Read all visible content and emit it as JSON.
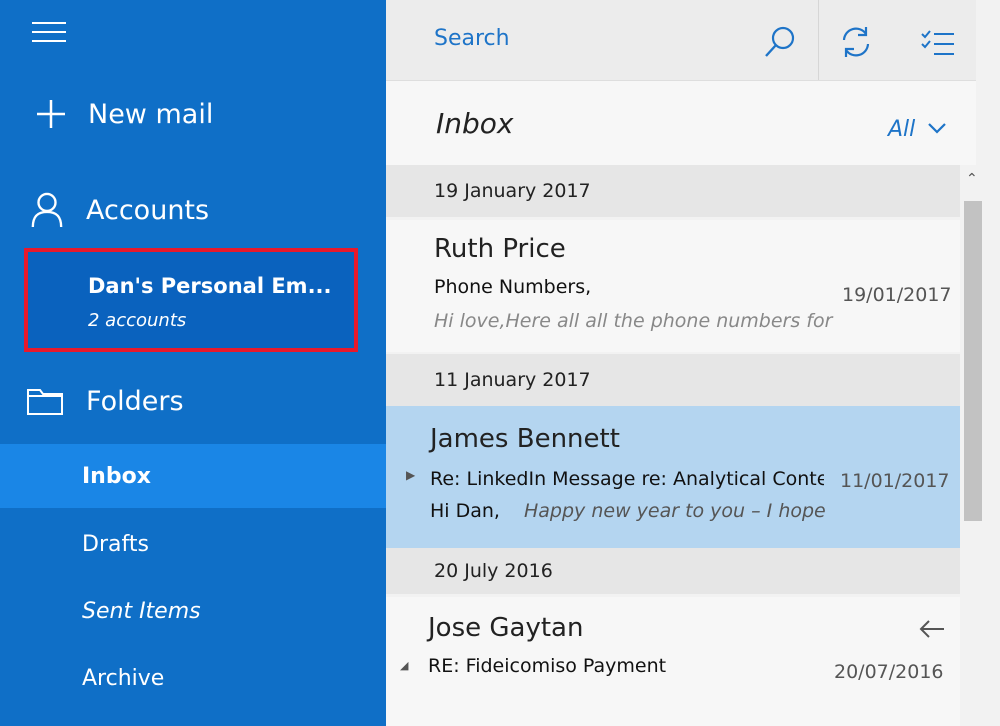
{
  "sidebar": {
    "new_mail": "New mail",
    "accounts": "Accounts",
    "account": {
      "name": "Dan's Personal Em...",
      "sub": "2 accounts"
    },
    "folders": "Folders",
    "folder_items": [
      {
        "label": "Inbox",
        "active": true
      },
      {
        "label": "Drafts"
      },
      {
        "label": "Sent Items"
      },
      {
        "label": "Archive"
      }
    ]
  },
  "topbar": {
    "search_placeholder": "Search",
    "icons": [
      "search-icon",
      "sync-icon",
      "select-icon"
    ]
  },
  "inbox": {
    "title": "Inbox",
    "filter": "All"
  },
  "messages": {
    "groups": [
      {
        "date": "19 January 2017",
        "items": [
          {
            "sender": "Ruth Price",
            "subject": "Phone Numbers,",
            "preview": "Hi love,Here all all the phone numbers for",
            "date": "19/01/2017"
          }
        ]
      },
      {
        "date": "11 January 2017",
        "items": [
          {
            "sender": "James Bennett",
            "subject": "Re: LinkedIn Message re: Analytical Conte",
            "preview_prefix": "Hi Dan,",
            "preview": "Happy new year to you – I hope",
            "date": "11/01/2017",
            "selected": true
          }
        ]
      },
      {
        "date": "20 July 2016",
        "items": [
          {
            "sender": "Jose Gaytan",
            "subject": "RE: Fideicomiso Payment",
            "date": "20/07/2016",
            "icon": "reply-arrow-icon"
          }
        ]
      }
    ]
  },
  "colors": {
    "sidebar": "#0f6fc7",
    "sidebar_active": "#1a86e6",
    "highlight": "#e8192c",
    "accent": "#1e74c8",
    "selected_row": "#b4d5f0"
  }
}
